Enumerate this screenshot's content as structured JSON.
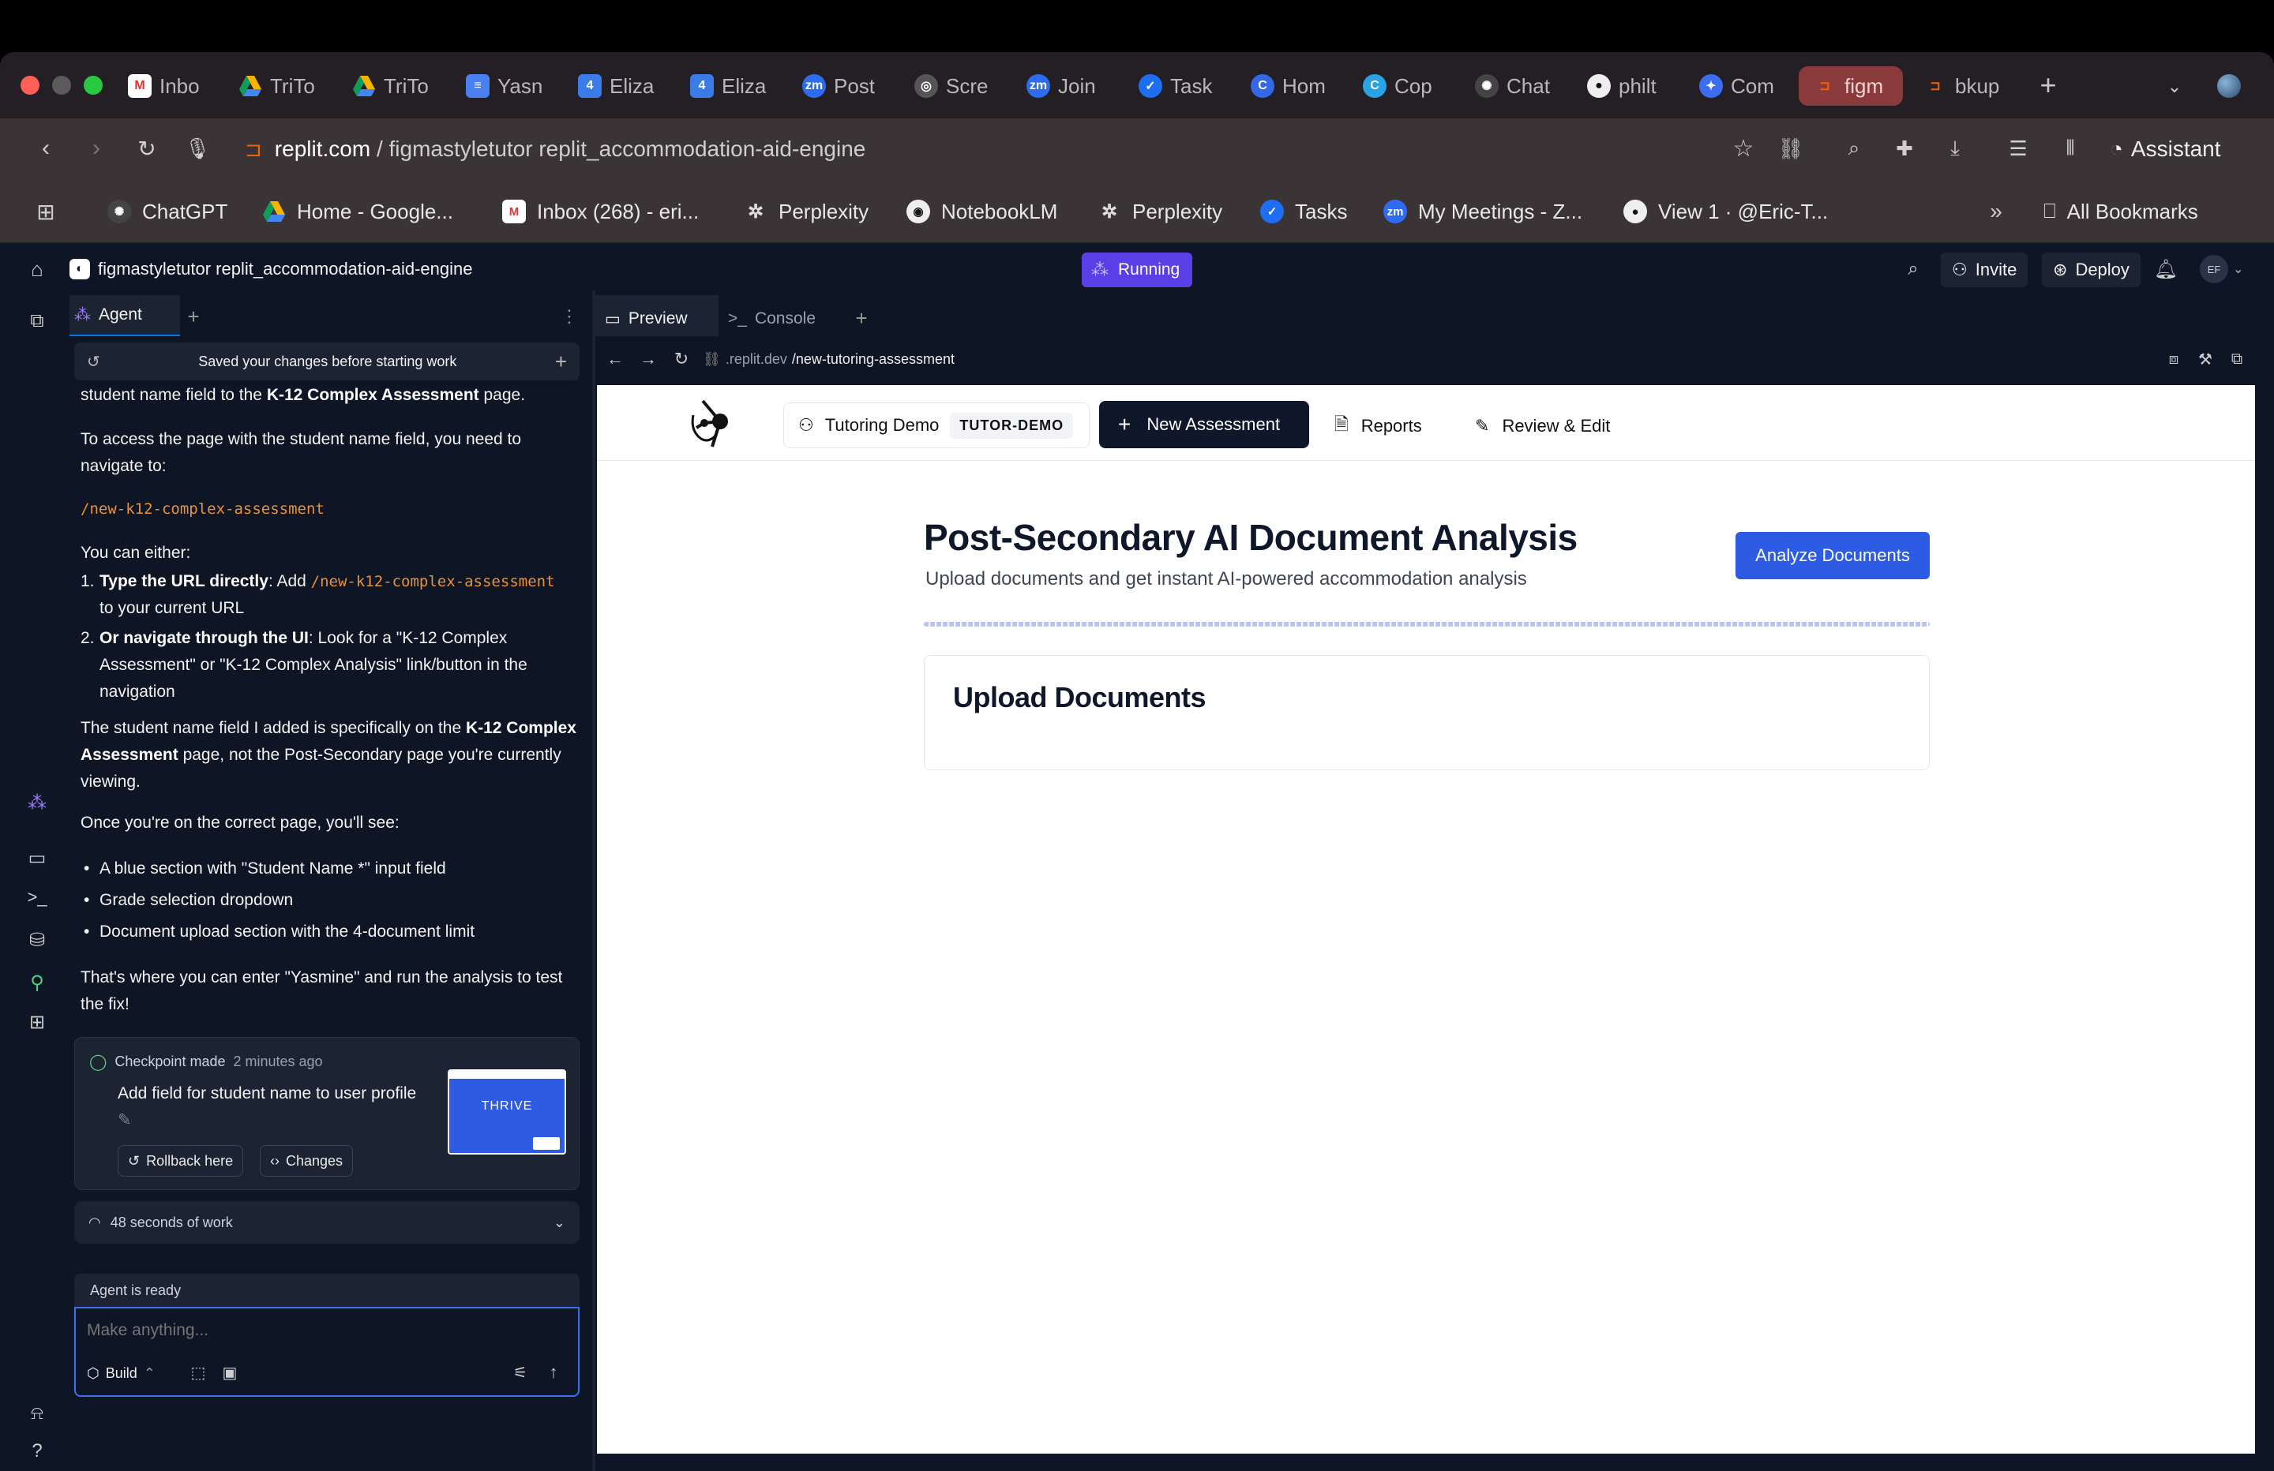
{
  "browser": {
    "tabs": [
      {
        "label": "Inbo",
        "icon": "gmail-icon"
      },
      {
        "label": "TriTo",
        "icon": "google-drive-icon"
      },
      {
        "label": "TriTo",
        "icon": "google-drive-icon"
      },
      {
        "label": "Yasn",
        "icon": "google-docs-icon"
      },
      {
        "label": "Eliza",
        "icon": "calendar-icon"
      },
      {
        "label": "Eliza",
        "icon": "calendar-icon"
      },
      {
        "label": "Post",
        "icon": "zoom-icon"
      },
      {
        "label": "Scre",
        "icon": "globe-icon"
      },
      {
        "label": "Join",
        "icon": "zoom-icon"
      },
      {
        "label": "Task",
        "icon": "tasks-icon"
      },
      {
        "label": "Hom",
        "icon": "canva-icon"
      },
      {
        "label": "Cop",
        "icon": "canva-icon"
      },
      {
        "label": "Chat",
        "icon": "chatgpt-icon"
      },
      {
        "label": "philt",
        "icon": "github-icon"
      },
      {
        "label": "Com",
        "icon": "gemini-icon"
      },
      {
        "label": "figm",
        "icon": "replit-icon"
      },
      {
        "label": "bkup",
        "icon": "replit-icon"
      }
    ],
    "url_domain": "replit.com",
    "url_path": " / figmastyletutor replit_accommodation-aid-engine",
    "assistant_label": "Assistant",
    "bookmarks": [
      {
        "label": "ChatGPT",
        "icon": "chatgpt-icon"
      },
      {
        "label": "Home - Google...",
        "icon": "google-drive-icon"
      },
      {
        "label": "Inbox (268) - eri...",
        "icon": "gmail-icon"
      },
      {
        "label": "Perplexity",
        "icon": "perplexity-icon"
      },
      {
        "label": "NotebookLM",
        "icon": "notebooklm-icon"
      },
      {
        "label": "Perplexity",
        "icon": "perplexity-icon"
      },
      {
        "label": "Tasks",
        "icon": "tasks-icon"
      },
      {
        "label": "My Meetings - Z...",
        "icon": "zoom-icon"
      },
      {
        "label": "View 1 · @Eric-T...",
        "icon": "github-icon"
      }
    ],
    "all_bookmarks_label": "All Bookmarks"
  },
  "replit": {
    "project_name": "figmastyletutor replit_accommodation-aid-engine",
    "status": "Running",
    "invite_label": "Invite",
    "deploy_label": "Deploy",
    "avatar_initials": "EF",
    "agent_tab": "Agent",
    "saved_banner": "Saved your changes before starting work",
    "chat": {
      "line1_pre": "student name field to the ",
      "line1_bold": "K-12 Complex Assessment",
      "line1_post": " page.",
      "para2": "To access the page with the student name field, you need to navigate to:",
      "path": "/new-k12-complex-assessment",
      "either": "You can either:",
      "opt1_num": "1.",
      "opt1_bold": "Type the URL directly",
      "opt1_text": ": Add ",
      "opt1_code": "/new-k12-complex-assessment",
      "opt1_tail": "to your current URL",
      "opt2_num": "2.",
      "opt2_bold": "Or navigate through the UI",
      "opt2_text": ": Look for a \"K-12 Complex Assessment\" or \"K-12 Complex Analysis\" link/button in the navigation",
      "para3_pre": "The student name field I added is specifically on the ",
      "para3_bold": "K-12 Complex Assessment",
      "para3_post": " page, not the Post-Secondary page you're currently viewing.",
      "para4": "Once you're on the correct page, you'll see:",
      "bullets": [
        "A blue section with \"Student Name *\" input field",
        "Grade selection dropdown",
        "Document upload section with the 4-document limit"
      ],
      "para5": "That's where you can enter \"Yasmine\" and run the analysis to test the fix!"
    },
    "checkpoint": {
      "label": "Checkpoint made",
      "time": "2 minutes ago",
      "title": "Add field for student name to user profile",
      "rollback": "Rollback here",
      "changes": "Changes",
      "thumb_text": "THRIVE"
    },
    "work_label": "48 seconds of work",
    "ready_label": "Agent is ready",
    "input_placeholder": "Make anything...",
    "build_label": "Build",
    "preview_tab": "Preview",
    "console_tab": "Console",
    "preview_url_host": ".replit.dev",
    "preview_url_path": "/new-tutoring-assessment"
  },
  "app": {
    "org_name": "Tutoring Demo",
    "org_badge": "TUTOR-DEMO",
    "new_assessment": "New Assessment",
    "reports": "Reports",
    "review_edit": "Review & Edit",
    "page_title": "Post-Secondary AI Document Analysis",
    "page_subtitle": "Upload documents and get instant AI-powered accommodation analysis",
    "analyze_button": "Analyze Documents",
    "upload_title": "Upload Documents"
  },
  "colors": {
    "accent_blue": "#2d5be3",
    "running_purple": "#5a3ee6",
    "active_tab": "#8a3a3a",
    "code_orange": "#e8913a"
  }
}
